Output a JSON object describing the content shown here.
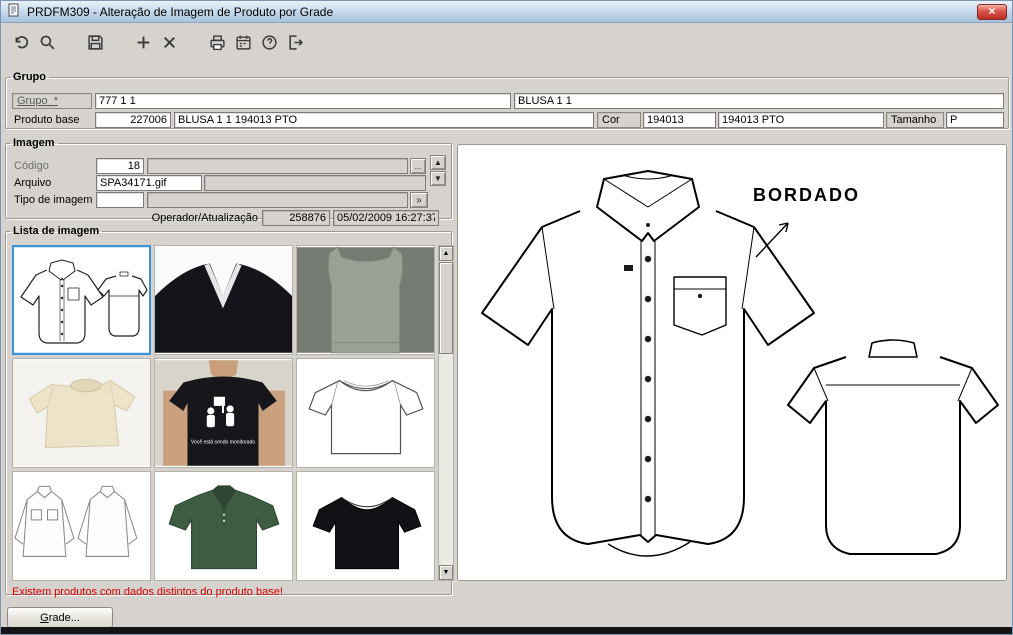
{
  "window": {
    "title": "PRDFM309 - Alteração de Imagem de Produto por Grade"
  },
  "ui": {
    "close": "×",
    "up": "▲",
    "down": "▼",
    "more": "»",
    "lookup": "...",
    "scroll_up": "▲",
    "scroll_down": "▼"
  },
  "toolbar": {
    "icons": [
      "undo",
      "search",
      "save",
      "add",
      "delete",
      "print",
      "calendar",
      "help",
      "exit"
    ]
  },
  "grupo": {
    "legend": "Grupo",
    "grupo_link": "Grupo_*",
    "grupo_code": "777 1 1",
    "grupo_desc": "BLUSA 1 1",
    "produto_label": "Produto base",
    "produto_code": "227006",
    "produto_desc": "BLUSA 1 1 194013 PTO",
    "cor_label": "Cor",
    "cor_code": "194013",
    "cor_desc": "194013 PTO",
    "tamanho_label": "Tamanho",
    "tamanho_value": "P"
  },
  "imagem": {
    "legend": "Imagem",
    "codigo_label": "Código",
    "codigo_value": "18",
    "arquivo_label": "Arquivo",
    "arquivo_value": "SPA34171.gif",
    "tipo_label": "Tipo de imagem",
    "tipo_value": "",
    "operador_label": "Operador/Atualização",
    "operador_user": "258876",
    "operador_date": "05/02/2009 16:27:37"
  },
  "lista": {
    "legend": "Lista de imagem",
    "warning": "Existem produtos com dados distintos do produto base!",
    "thumbnails": [
      {
        "name": "technical-shirt-drawing",
        "selected": true
      },
      {
        "name": "black-vneck-sweater"
      },
      {
        "name": "gray-sleeveless-top"
      },
      {
        "name": "ivory-tshirt-photo"
      },
      {
        "name": "black-tshirt-worn",
        "caption": "Você está sendo monitorado"
      },
      {
        "name": "white-tshirt-drawing"
      },
      {
        "name": "two-shirts-drawing"
      },
      {
        "name": "green-polo-shirt"
      },
      {
        "name": "black-tshirt"
      }
    ]
  },
  "preview": {
    "annotation": "BORDADO"
  },
  "footer": {
    "grade_button": "Grade..."
  }
}
